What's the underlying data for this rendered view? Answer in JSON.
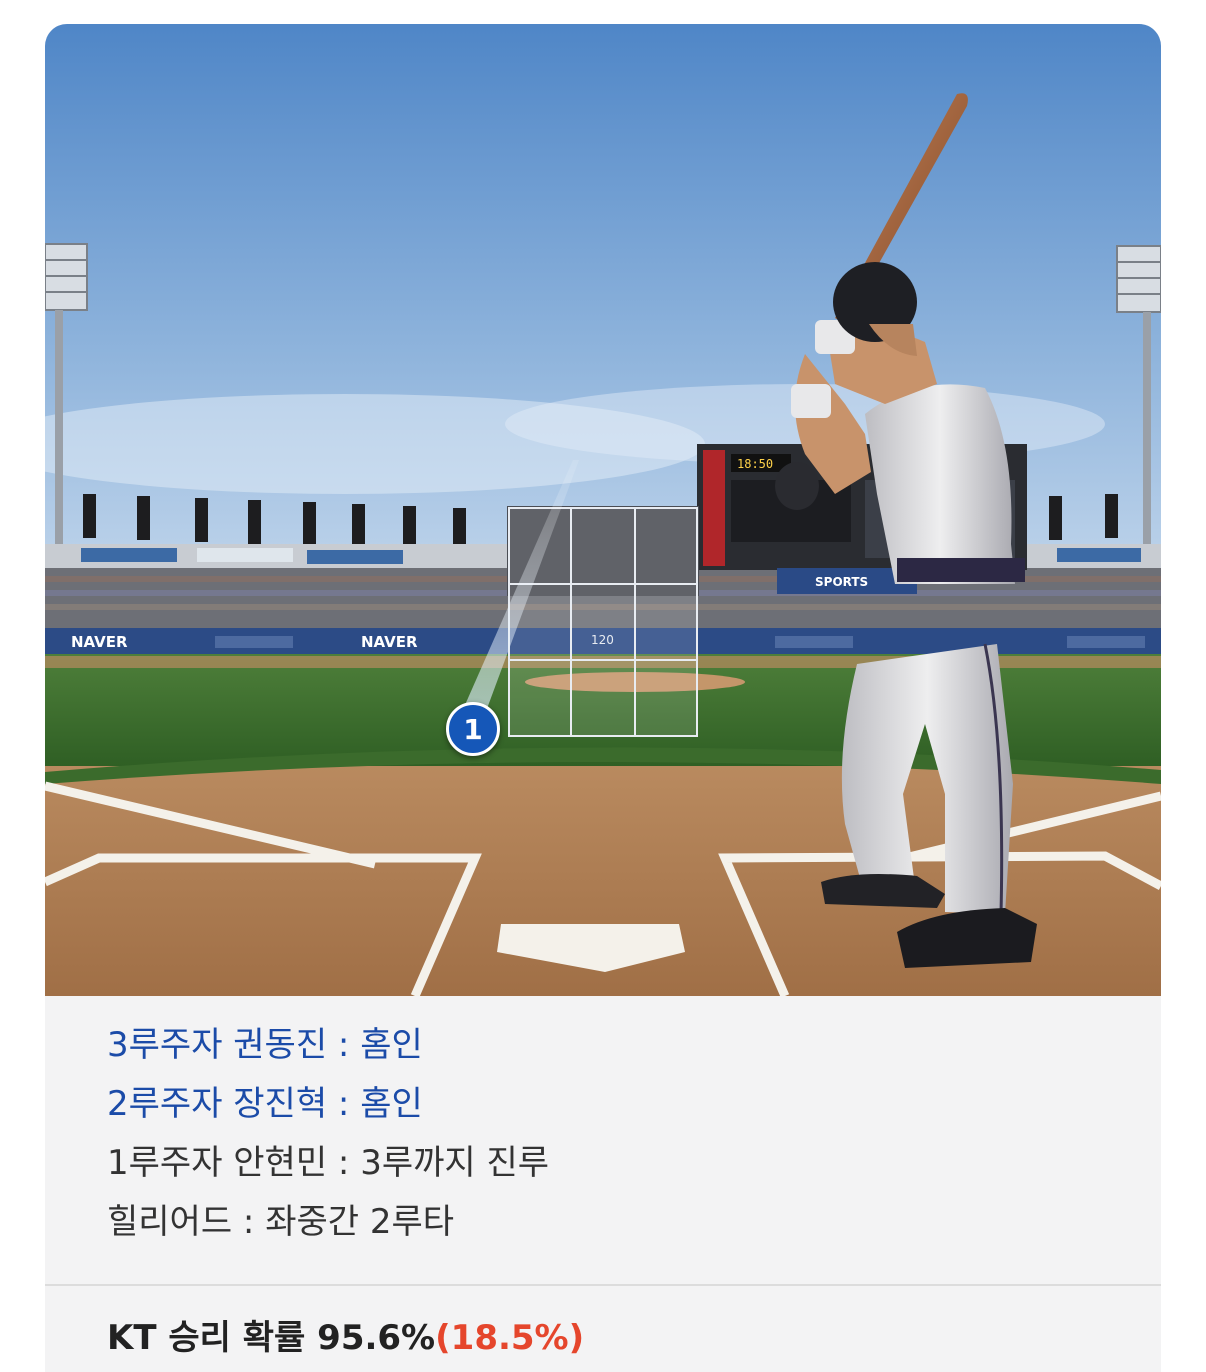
{
  "scene": {
    "pitch_marker_label": "1",
    "zone_speed": "120",
    "scoreboard_time": "18:50",
    "banners": {
      "naver_left": "NAVER",
      "naver_right": "NAVER",
      "sports_small": "SPORTS"
    }
  },
  "plays": [
    {
      "text": "3루주자 권동진 : 홈인",
      "highlight": true
    },
    {
      "text": "2루주자 장진혁 : 홈인",
      "highlight": true
    },
    {
      "text": "1루주자 안현민 : 3루까지 진루",
      "highlight": false
    },
    {
      "text": "힐리어드 : 좌중간 2루타",
      "highlight": false
    }
  ],
  "win_probability": {
    "label": "KT 승리 확률 95.6%",
    "delta": "(18.5%)",
    "delta_color": "#e5462c"
  },
  "colors": {
    "highlight_text": "#1b4ba8",
    "marker": "#1557b8"
  }
}
